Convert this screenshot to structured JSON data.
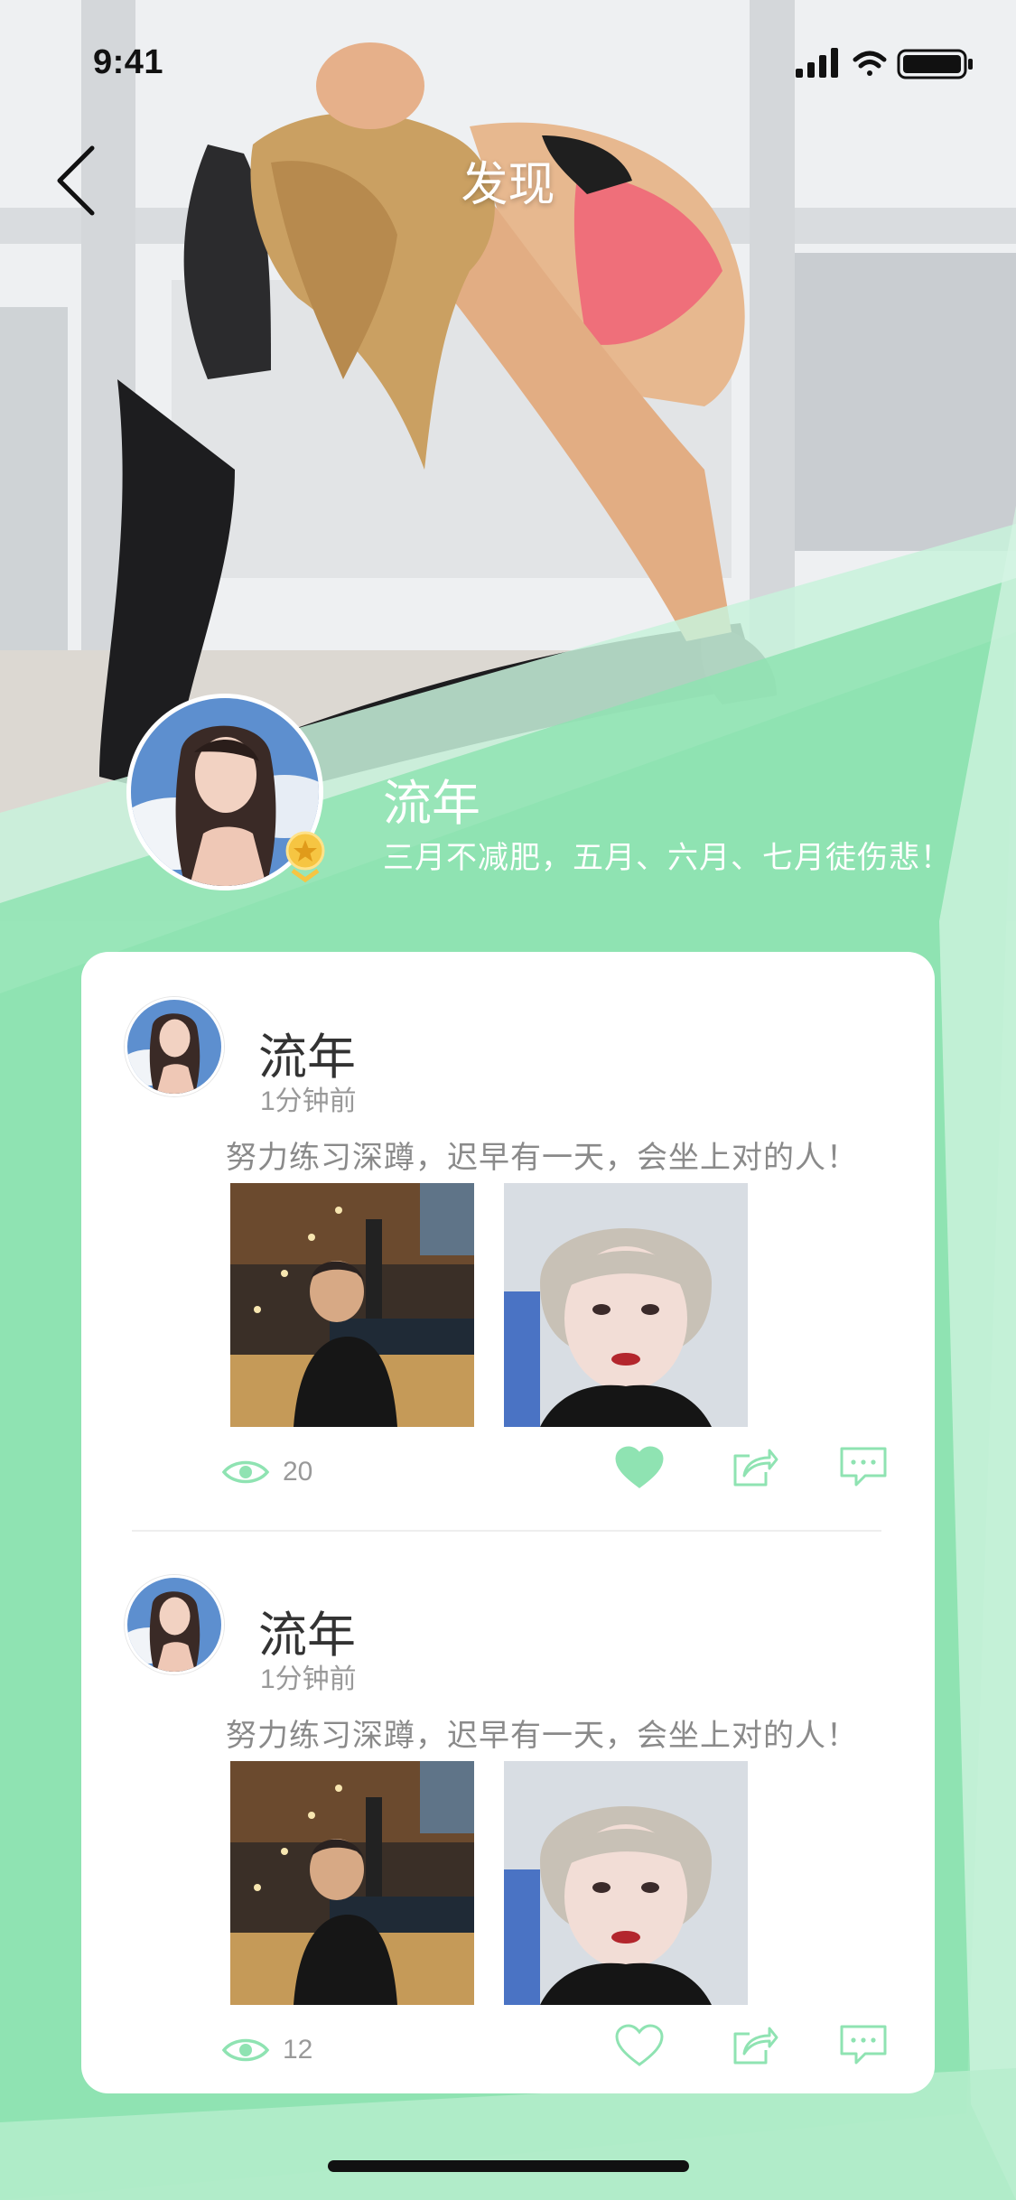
{
  "status_bar": {
    "time": "9:41"
  },
  "nav": {
    "title": "发现"
  },
  "profile": {
    "name": "流年",
    "bio": "三月不减肥，五月、六月、七月徒伤悲！"
  },
  "posts": [
    {
      "author": "流年",
      "time": "1分钟前",
      "text": "努力练习深蹲，迟早有一天，会坐上对的人！",
      "views": "20",
      "liked": true
    },
    {
      "author": "流年",
      "time": "1分钟前",
      "text": "努力练习深蹲，迟早有一天，会坐上对的人！",
      "views": "12",
      "liked": false
    }
  ],
  "colors": {
    "accent": "#8fe3b2",
    "accent_light": "#c8f2dc",
    "text_primary": "#333333",
    "text_secondary": "#999999"
  },
  "icons": [
    "back-icon",
    "signal-icon",
    "wifi-icon",
    "battery-icon",
    "badge-icon",
    "eye-icon",
    "heart-icon",
    "share-icon",
    "comment-icon"
  ]
}
